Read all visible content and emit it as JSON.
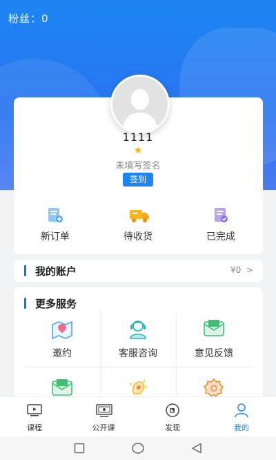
{
  "header": {
    "fans_label": "粉丝：",
    "fans_count": "0"
  },
  "profile": {
    "username": "1111",
    "signature": "未填写签名",
    "checkin_label": "签到"
  },
  "orders": [
    {
      "label": "新订单",
      "icon": "new-order-icon"
    },
    {
      "label": "待收货",
      "icon": "delivery-truck-icon"
    },
    {
      "label": "已完成",
      "icon": "completed-order-icon"
    }
  ],
  "account": {
    "title": "我的账户",
    "balance": "¥0",
    "chevron": ">"
  },
  "services": {
    "title": "更多服务",
    "items": [
      {
        "label": "邀约",
        "icon": "invite-map-icon"
      },
      {
        "label": "客服咨询",
        "icon": "customer-service-icon"
      },
      {
        "label": "意见反馈",
        "icon": "feedback-mail-icon"
      },
      {
        "label": "",
        "icon": "mail-icon"
      },
      {
        "label": "",
        "icon": "gift-bulb-icon"
      },
      {
        "label": "",
        "icon": "settings-gear-icon"
      }
    ]
  },
  "tabbar": {
    "tabs": [
      {
        "label": "课程",
        "icon": "video-course-icon"
      },
      {
        "label": "公开课",
        "icon": "public-class-icon"
      },
      {
        "label": "发现",
        "icon": "discover-compass-icon"
      },
      {
        "label": "我的",
        "icon": "user-profile-icon",
        "active": true
      }
    ]
  },
  "colors": {
    "primary": "#1d85f2",
    "accent_yellow": "#f6b81c",
    "teal": "#2bb5b8",
    "green": "#3fbf74",
    "orange": "#f28a2e"
  }
}
